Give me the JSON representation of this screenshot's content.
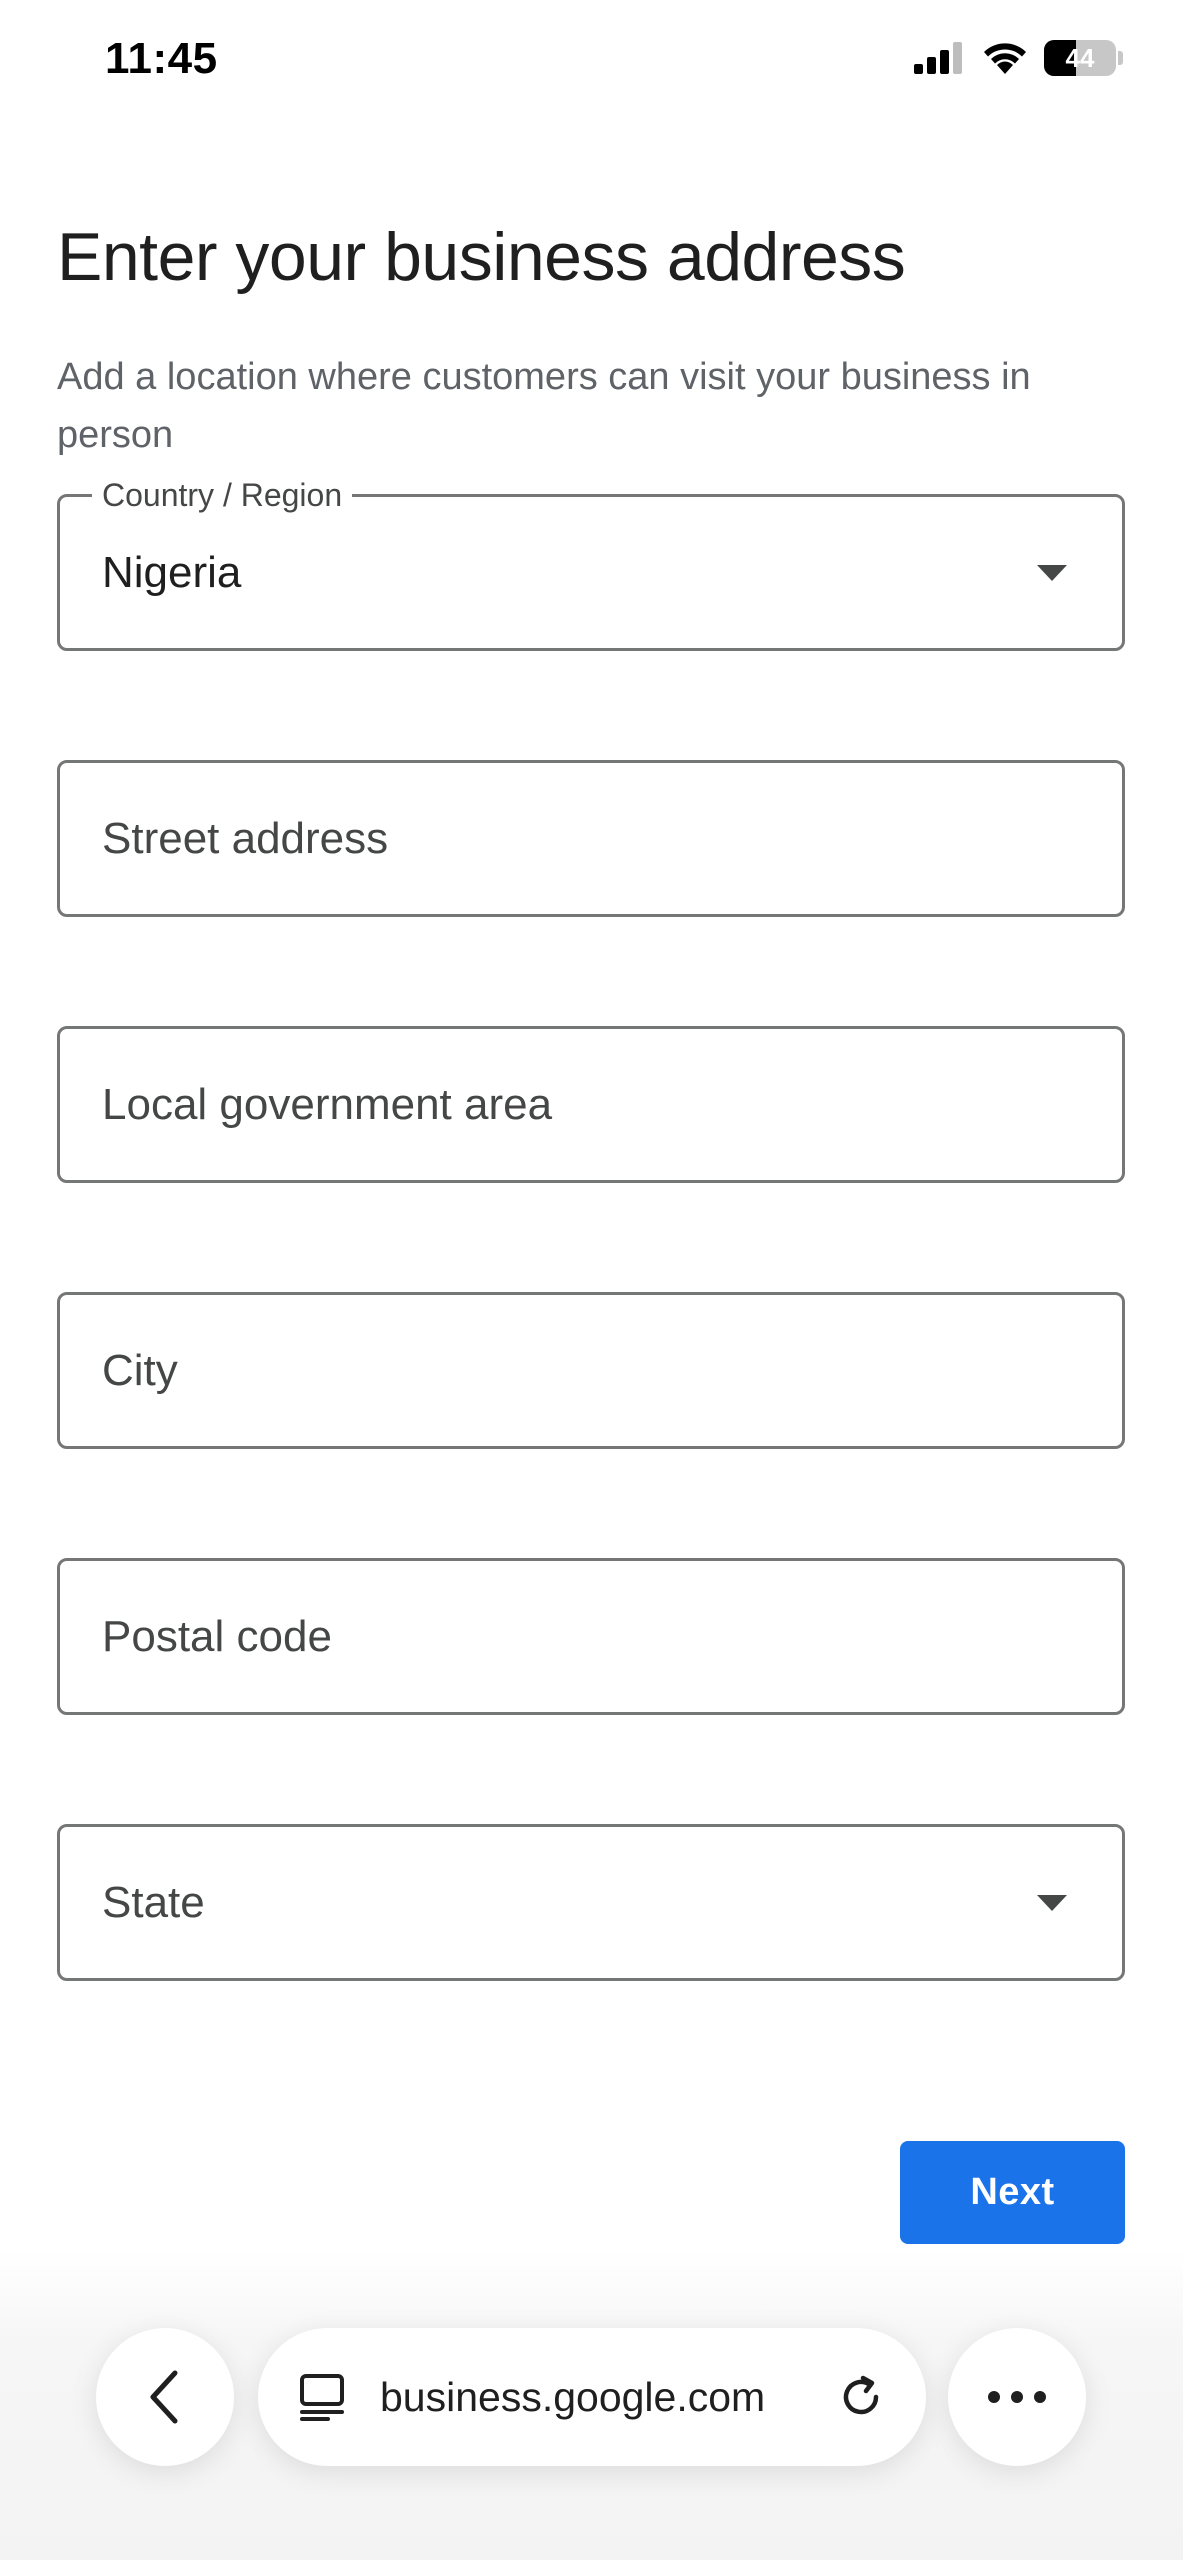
{
  "status_bar": {
    "time": "11:45",
    "battery_level": "44",
    "icons": [
      "cellular-signal-icon",
      "wifi-icon",
      "battery-icon"
    ]
  },
  "page": {
    "title": "Enter your business address",
    "subtitle": "Add a location where customers can visit your business in person"
  },
  "form": {
    "country": {
      "label": "Country / Region",
      "value": "Nigeria"
    },
    "street_address": {
      "placeholder": "Street address"
    },
    "lga": {
      "placeholder": "Local government area"
    },
    "city": {
      "placeholder": "City"
    },
    "postal_code": {
      "placeholder": "Postal code"
    },
    "state": {
      "placeholder": "State"
    }
  },
  "actions": {
    "next_label": "Next"
  },
  "browser": {
    "url": "business.google.com",
    "icons": [
      "back-icon",
      "tab-icon",
      "reload-icon",
      "more-icon"
    ]
  },
  "colors": {
    "primary": "#1a73e8",
    "border": "#747775",
    "text": "#1f1f1f",
    "secondary_text": "#5f6368"
  }
}
